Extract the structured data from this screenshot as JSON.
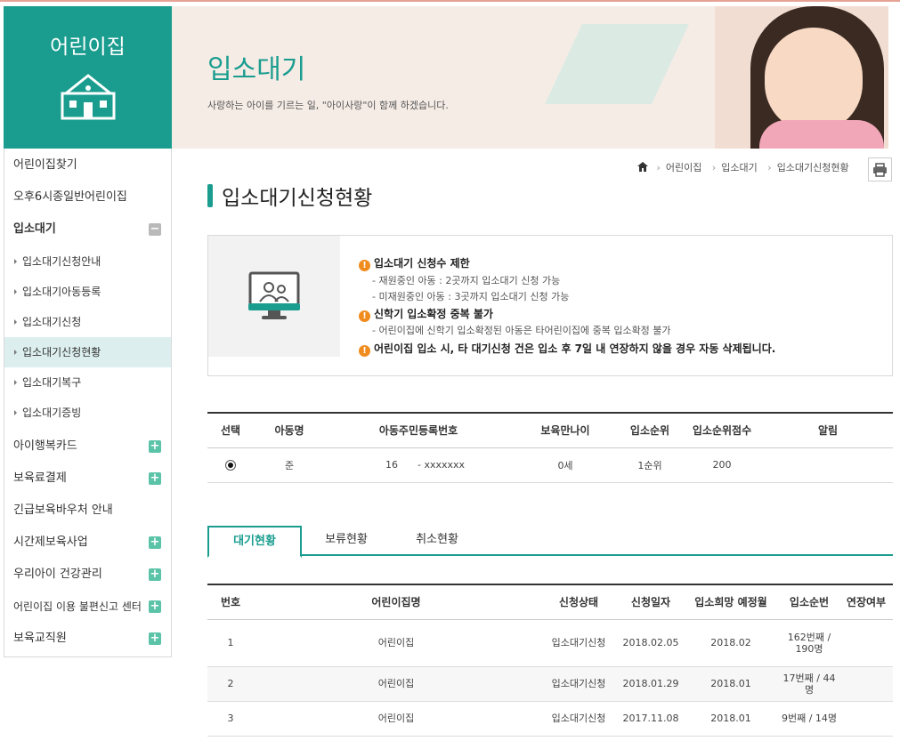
{
  "sidebar": {
    "title": "어린이집",
    "items": [
      {
        "label": "어린이집찾기"
      },
      {
        "label": "오후6시종일반어린이집"
      },
      {
        "label": "입소대기"
      },
      {
        "label": "입소대기신청안내"
      },
      {
        "label": "입소대기아동등록"
      },
      {
        "label": "입소대기신청"
      },
      {
        "label": "입소대기신청현황"
      },
      {
        "label": "입소대기복구"
      },
      {
        "label": "입소대기증빙"
      },
      {
        "label": "아이행복카드"
      },
      {
        "label": "보육료결제"
      },
      {
        "label": "긴급보육바우처 안내"
      },
      {
        "label": "시간제보육사업"
      },
      {
        "label": "우리아이 건강관리"
      },
      {
        "label": "어린이집 이용 불편신고 센터"
      },
      {
        "label": "보육교직원"
      }
    ]
  },
  "banner": {
    "title": "입소대기",
    "subtitle": "사랑하는 아이를 기르는 일, \"아이사랑\"이 함께 하겠습니다."
  },
  "breadcrumb": [
    "어린이집",
    "입소대기",
    "입소대기신청현황"
  ],
  "page_title": "입소대기신청현황",
  "notice": {
    "h1": "입소대기 신청수 제한",
    "l1": "- 재원중인 아동 : 2곳까지 입소대기 신청 가능",
    "l2": "- 미재원중인 아동 : 3곳까지 입소대기 신청 가능",
    "h2": "신학기 입소확정 중복 불가",
    "l3": "- 어린이집에 신학기 입소확정된 아동은 타어린이집에 중복 입소확정 불가",
    "h3": "어린이집 입소 시, 타 대기신청 건은 입소 후 7일 내 연장하지 않을 경우 자동 삭제됩니다."
  },
  "child_table": {
    "headers": [
      "선택",
      "아동명",
      "아동주민등록번호",
      "보육만나이",
      "입소순위",
      "입소순위점수",
      "알림"
    ],
    "row": {
      "name": "준",
      "rrn_front": "16",
      "rrn_back": "- xxxxxxx",
      "age": "0세",
      "rank": "1순위",
      "score": "200",
      "alert": ""
    }
  },
  "tabs": [
    "대기현황",
    "보류현황",
    "취소현황"
  ],
  "wait_table": {
    "headers": [
      "번호",
      "어린이집명",
      "신청상태",
      "신청일자",
      "입소희망 예정월",
      "입소순번",
      "연장여부"
    ],
    "rows": [
      {
        "no": "1",
        "name": "어린이집",
        "status": "입소대기신청",
        "date": "2018.02.05",
        "month": "2018.02",
        "order": "162번째 / 190명",
        "ext": ""
      },
      {
        "no": "2",
        "name": "어린이집",
        "status": "입소대기신청",
        "date": "2018.01.29",
        "month": "2018.01",
        "order": "17번째 / 44명",
        "ext": ""
      },
      {
        "no": "3",
        "name": "어린이집",
        "status": "입소대기신청",
        "date": "2017.11.08",
        "month": "2018.01",
        "order": "9번째 / 14명",
        "ext": ""
      }
    ]
  },
  "colors": {
    "accent": "#1a9d8f",
    "warning": "#f08c1e"
  },
  "icons": [
    "house-icon",
    "home-icon",
    "print-icon",
    "plus-icon",
    "minus-icon",
    "monitor-people-icon",
    "exclamation-icon"
  ]
}
